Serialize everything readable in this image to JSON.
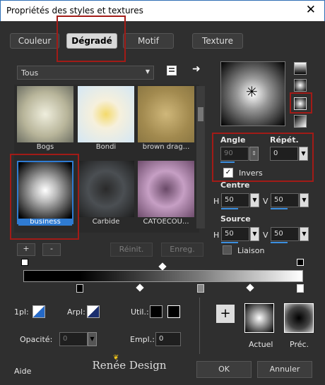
{
  "window": {
    "title": "Propriétés des styles et textures",
    "close": "✕"
  },
  "tabs": [
    {
      "label": "Couleur"
    },
    {
      "label": "Dégradé"
    },
    {
      "label": "Motif"
    },
    {
      "label": "Texture"
    }
  ],
  "category": {
    "value": "Tous"
  },
  "gallery": [
    {
      "label": "Bogs"
    },
    {
      "label": "Bondi"
    },
    {
      "label": "brown drag..."
    },
    {
      "label": "business"
    },
    {
      "label": "Carbide"
    },
    {
      "label": "CATOECOU..."
    }
  ],
  "gallery_buttons": {
    "add": "+",
    "remove": "-",
    "reset": "Réinit.",
    "save": "Enreg."
  },
  "angle": {
    "label": "Angle",
    "value": "90"
  },
  "repeat": {
    "label": "Répét.",
    "value": "0"
  },
  "invert": {
    "label": "Invers",
    "checked": true
  },
  "center": {
    "label": "Centre",
    "h_label": "H",
    "h": "50",
    "v_label": "V",
    "v": "50"
  },
  "source": {
    "label": "Source",
    "h_label": "H",
    "h": "50",
    "v_label": "V",
    "v": "50"
  },
  "link": {
    "label": "Liaison"
  },
  "bottom": {
    "fg_label": "1pl:",
    "bg_label": "Arpl:",
    "user_label": "Util.:",
    "opacity_label": "Opacité:",
    "opacity_value": "0",
    "location_label": "Empl.:",
    "location_value": "0"
  },
  "preview": {
    "current": "Actuel",
    "previous": "Préc."
  },
  "footer": {
    "help": "Aide",
    "ok": "OK",
    "cancel": "Annuler",
    "watermark": "Renée Design"
  },
  "colors": {
    "accent": "#3b8fe0",
    "annotation": "#a21b17"
  }
}
